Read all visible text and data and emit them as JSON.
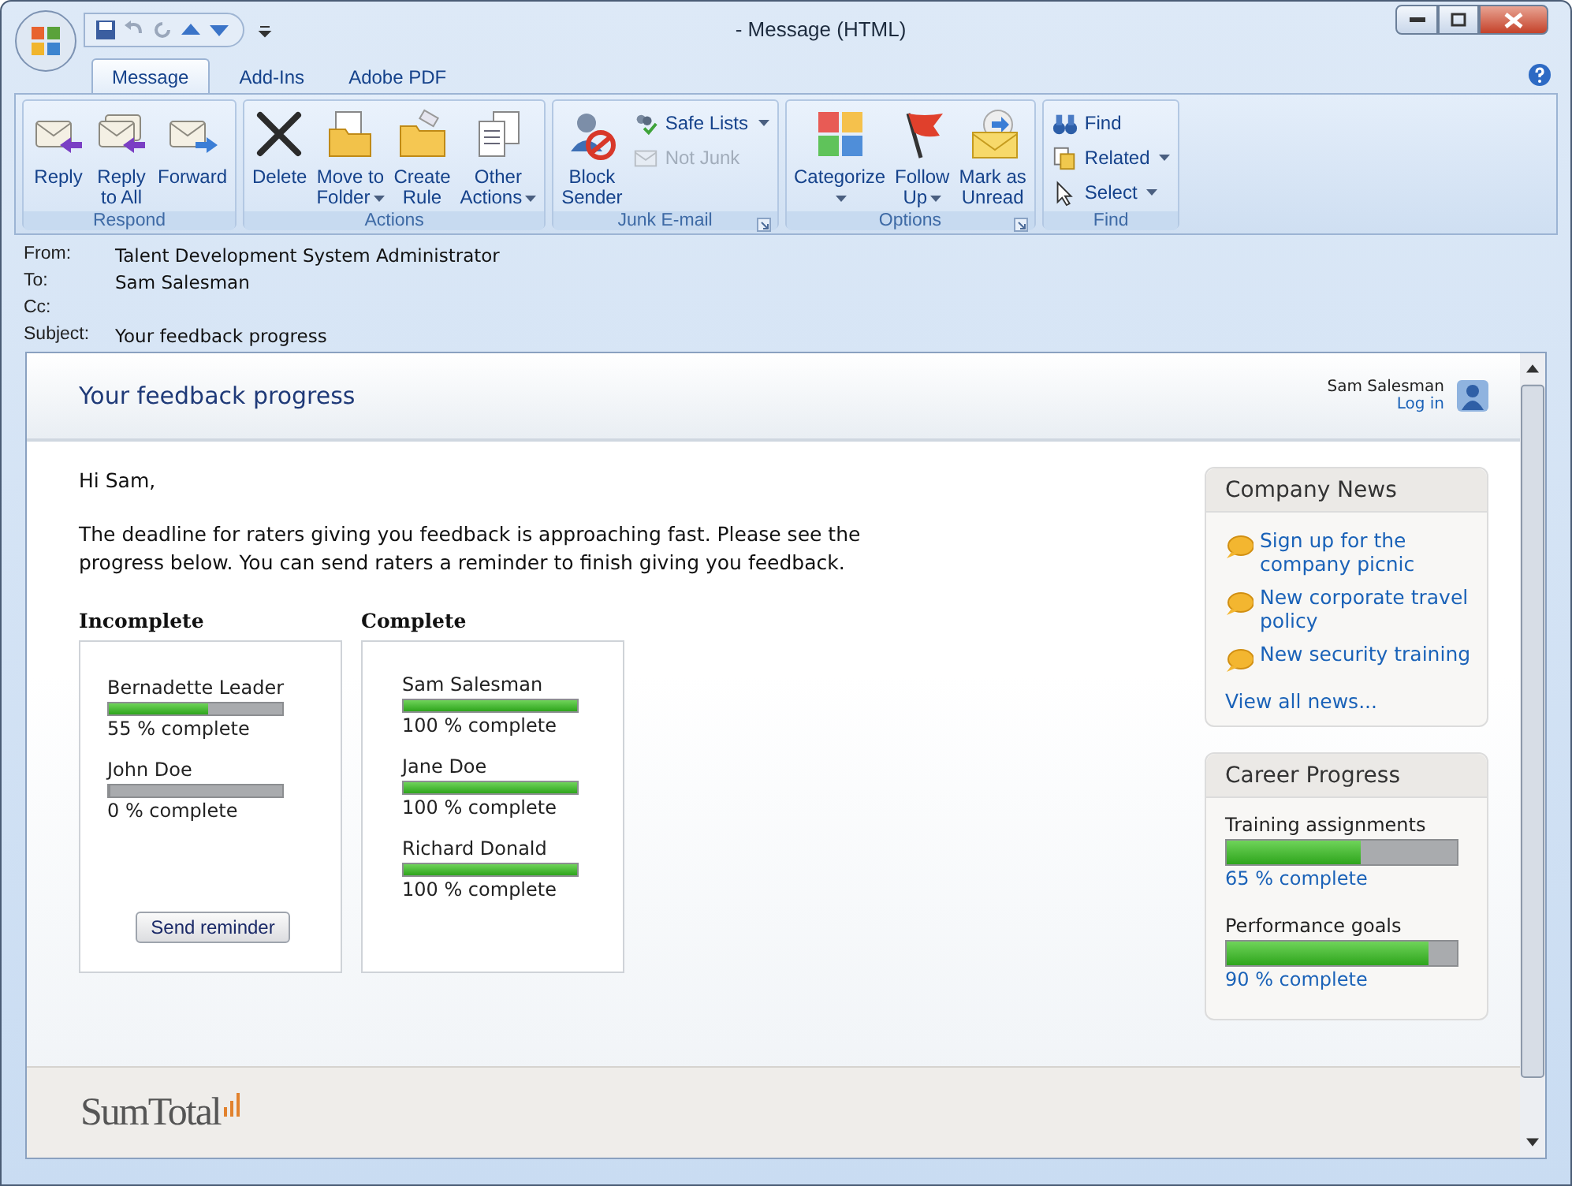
{
  "window": {
    "title": "- Message (HTML)"
  },
  "tabs": [
    {
      "label": "Message",
      "selected": true
    },
    {
      "label": "Add-Ins",
      "selected": false
    },
    {
      "label": "Adobe PDF",
      "selected": false
    }
  ],
  "ribbon": [
    {
      "label": "Respond",
      "launcher": false,
      "buttons": [
        {
          "kind": "large",
          "lines": [
            "Reply"
          ],
          "dropdown": false,
          "disabled": false
        },
        {
          "kind": "large",
          "lines": [
            "Reply",
            "to All"
          ],
          "dropdown": false,
          "disabled": false
        },
        {
          "kind": "large",
          "lines": [
            "Forward"
          ],
          "dropdown": false,
          "disabled": false
        }
      ]
    },
    {
      "label": "Actions",
      "launcher": false,
      "buttons": [
        {
          "kind": "large",
          "lines": [
            "Delete"
          ],
          "dropdown": false,
          "disabled": false
        },
        {
          "kind": "large",
          "lines": [
            "Move to",
            "Folder"
          ],
          "dropdown": true,
          "disabled": false
        },
        {
          "kind": "large",
          "lines": [
            "Create",
            "Rule"
          ],
          "dropdown": false,
          "disabled": false
        },
        {
          "kind": "large",
          "lines": [
            "Other",
            "Actions"
          ],
          "dropdown": true,
          "disabled": false
        }
      ]
    },
    {
      "label": "Junk E-mail",
      "launcher": true,
      "buttons": [
        {
          "kind": "large",
          "lines": [
            "Block",
            "Sender"
          ],
          "dropdown": false,
          "disabled": false
        },
        {
          "kind": "small",
          "lines": [
            "Safe Lists"
          ],
          "dropdown": true,
          "disabled": false
        },
        {
          "kind": "small",
          "lines": [
            "Not Junk"
          ],
          "dropdown": false,
          "disabled": true
        }
      ]
    },
    {
      "label": "Options",
      "launcher": true,
      "buttons": [
        {
          "kind": "large",
          "lines": [
            "Categorize"
          ],
          "dropdown": true,
          "disabled": false
        },
        {
          "kind": "large",
          "lines": [
            "Follow",
            "Up"
          ],
          "dropdown": true,
          "disabled": false
        },
        {
          "kind": "large",
          "lines": [
            "Mark as",
            "Unread"
          ],
          "dropdown": false,
          "disabled": false
        }
      ]
    },
    {
      "label": "Find",
      "launcher": false,
      "buttons": [
        {
          "kind": "small",
          "lines": [
            "Find"
          ],
          "dropdown": false,
          "disabled": false
        },
        {
          "kind": "small",
          "lines": [
            "Related"
          ],
          "dropdown": true,
          "disabled": false
        },
        {
          "kind": "small",
          "lines": [
            "Select"
          ],
          "dropdown": true,
          "disabled": false
        }
      ]
    }
  ],
  "headers": [
    {
      "label": "From:",
      "value": "Talent Development System Administrator"
    },
    {
      "label": "To:",
      "value": "Sam Salesman"
    },
    {
      "label": "Cc:"
    },
    {
      "label": "Subject:",
      "value": "Your feedback progress"
    }
  ],
  "email": {
    "banner": {
      "title": "Your feedback progress",
      "user": "Sam Salesman",
      "login": "Log in"
    },
    "greeting": "Hi Sam,",
    "intro": "The deadline for raters giving you feedback is approaching fast. Please see the progress below. You can send raters a reminder to finish giving you feedback.",
    "columns": [
      {
        "heading": "Incomplete",
        "button": "Send reminder",
        "raters": [
          {
            "name": "Bernadette Leader",
            "level": 0.57,
            "reading": "55 % complete"
          },
          {
            "name": "John Doe",
            "level": 0,
            "reading": "0 % complete"
          }
        ]
      },
      {
        "heading": "Complete",
        "raters": [
          {
            "name": "Sam Salesman",
            "level": 1,
            "reading": "100 % complete"
          },
          {
            "name": "Jane Doe",
            "level": 1,
            "reading": "100 % complete"
          },
          {
            "name": "Richard Donald",
            "level": 1,
            "reading": "100 % complete"
          }
        ]
      }
    ],
    "news": {
      "title": "Company News",
      "items": [
        "Sign up for the company picnic",
        "New corporate travel policy",
        "New security training"
      ],
      "more": "View all news..."
    },
    "career": {
      "title": "Career Progress",
      "items": [
        {
          "label": "Training assignments",
          "level": 0.58,
          "reading": "65 % complete"
        },
        {
          "label": "Performance goals",
          "level": 0.88,
          "reading": "90 % complete"
        }
      ]
    },
    "footer": {
      "logo": "SumTotal"
    }
  }
}
